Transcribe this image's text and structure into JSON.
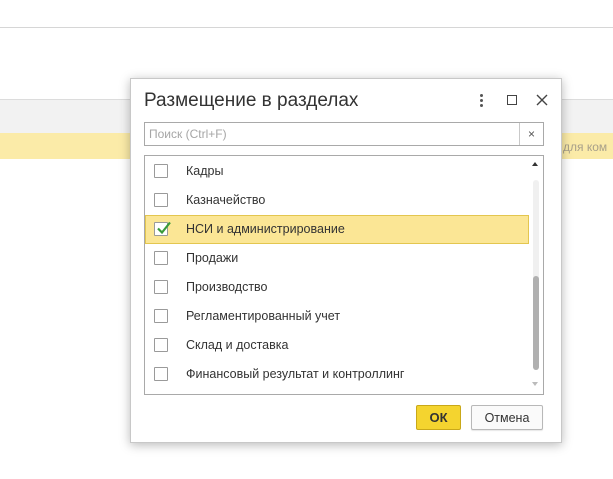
{
  "background": {
    "hint_text": "для ком"
  },
  "dialog": {
    "title": "Размещение в разделах",
    "search": {
      "placeholder": "Поиск (Ctrl+F)",
      "value": "",
      "clear_glyph": "×"
    },
    "items": [
      {
        "label": "Кадры",
        "checked": false
      },
      {
        "label": "Казначейство",
        "checked": false
      },
      {
        "label": "НСИ и администрирование",
        "checked": true
      },
      {
        "label": "Продажи",
        "checked": false
      },
      {
        "label": "Производство",
        "checked": false
      },
      {
        "label": "Регламентированный учет",
        "checked": false
      },
      {
        "label": "Склад и доставка",
        "checked": false
      },
      {
        "label": "Финансовый результат и контроллинг",
        "checked": false
      }
    ],
    "selected_index": 2,
    "buttons": {
      "ok": "ОК",
      "cancel": "Отмена"
    }
  },
  "colors": {
    "selection_fill": "#fbe695",
    "ok_button": "#f4d42f",
    "check_mark": "#3a9a3a"
  }
}
